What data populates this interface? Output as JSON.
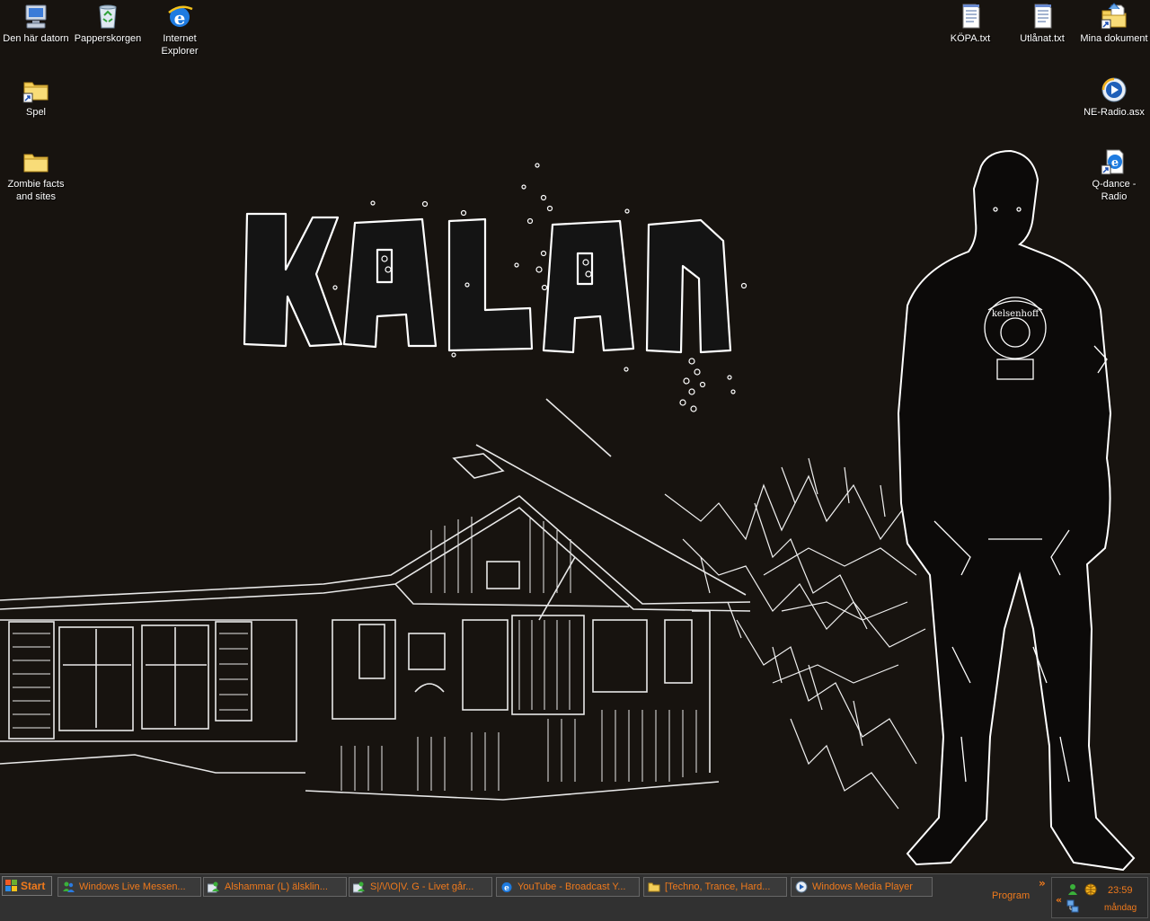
{
  "wallpaper": {
    "title_text": "KALAN",
    "shirt_text": "kelsenhoff"
  },
  "icons": {
    "my_computer": {
      "label": "Den här datorn",
      "icon": "computer-icon"
    },
    "recycle_bin": {
      "label": "Papperskorgen",
      "icon": "recycle-bin-icon"
    },
    "internet_explorer": {
      "label": "Internet Explorer",
      "icon": "ie-icon"
    },
    "spel": {
      "label": "Spel",
      "icon": "folder-shortcut-icon"
    },
    "zombie": {
      "label": "Zombie facts and sites",
      "icon": "folder-icon"
    },
    "kopa": {
      "label": "KÖPA.txt",
      "icon": "text-file-icon"
    },
    "utlanat": {
      "label": "Utlånat.txt",
      "icon": "text-file-icon"
    },
    "mina_dokument": {
      "label": "Mina dokument",
      "icon": "documents-folder-icon"
    },
    "ne_radio": {
      "label": "NE-Radio.asx",
      "icon": "media-file-icon"
    },
    "qdance": {
      "label": "Q-dance - Radio",
      "icon": "ie-shortcut-icon"
    }
  },
  "taskbar": {
    "start_label": "Start",
    "tasks": [
      {
        "label": "Windows Live Messen...",
        "icon": "messenger-icon"
      },
      {
        "label": "Alshammar (L) älsklin...",
        "icon": "messenger-chat-icon"
      },
      {
        "label": "S|/\\/\\O|V. G - Livet går...",
        "icon": "messenger-chat-icon"
      },
      {
        "label": "YouTube - Broadcast Y...",
        "icon": "ie-icon"
      },
      {
        "label": "[Techno, Trance, Hard...",
        "icon": "folder-icon"
      },
      {
        "label": "Windows Media Player",
        "icon": "media-player-icon"
      }
    ],
    "program_label": "Program",
    "program_chevron": "»",
    "tray_chevron": "«",
    "clock_time": "23:59",
    "clock_day": "måndag"
  },
  "colors": {
    "taskbar_text": "#f07a1c",
    "desktop_bg": "#17130f",
    "outline": "#ffffff"
  }
}
